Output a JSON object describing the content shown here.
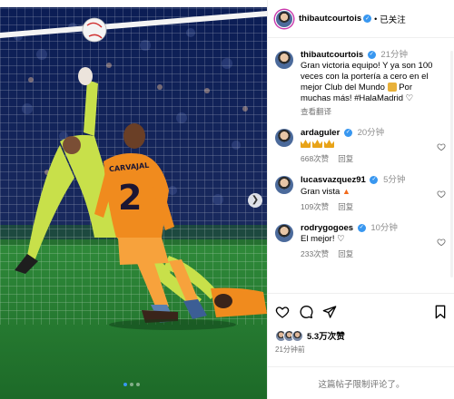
{
  "post": {
    "author": "thibautcourtois",
    "follow_status": "已关注",
    "caption_username": "thibautcourtois",
    "caption_time": "21分钟",
    "caption_text": "Gran victoria equipo! Y ya son 100 veces con la portería a cero en el mejor Club del Mundo",
    "caption_text_2": "Por muchas más! #HalaMadrid",
    "see_translation": "查看翻译"
  },
  "photo": {
    "jersey_number": "2",
    "jersey_name": "CARVAJAL"
  },
  "comments": [
    {
      "username": "ardaguler",
      "time": "20分钟",
      "text": "",
      "likes": "668次赞",
      "reply": "回复"
    },
    {
      "username": "lucasvazquez91",
      "time": "5分钟",
      "text": "Gran vista",
      "likes": "109次赞",
      "reply": "回复"
    },
    {
      "username": "rodrygogoes",
      "time": "10分钟",
      "text": "El mejor!",
      "likes": "233次赞",
      "reply": "回复"
    }
  ],
  "engagement": {
    "like_count": "5.3万次赞",
    "posted_ago": "21分钟前",
    "comments_disabled": "这篇帖子限制评论了。"
  },
  "icons": {
    "verified": "verified-icon",
    "like": "heart-icon",
    "comment": "comment-icon",
    "share": "send-icon",
    "save": "bookmark-icon",
    "next": "chevron-right-icon"
  },
  "colors": {
    "verified": "#3897f0",
    "link": "#00376b",
    "muted": "#737373",
    "divider": "#efefef"
  }
}
